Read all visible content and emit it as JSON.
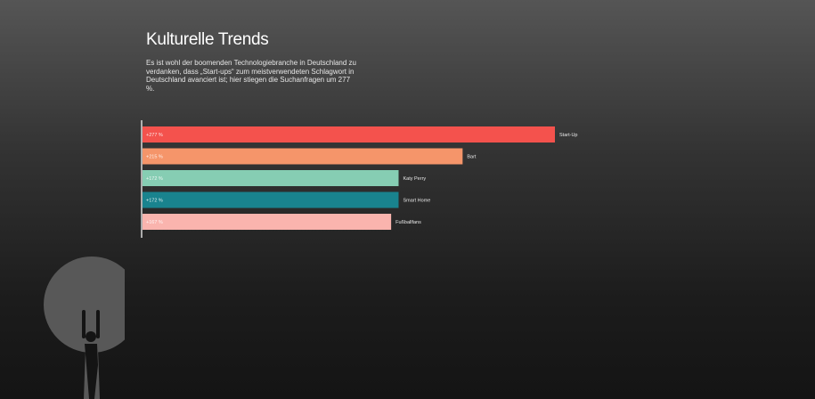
{
  "header": {
    "title": "Kulturelle Trends",
    "description": "Es ist wohl der boomenden Technologiebranche in Deutschland zu verdanken, dass „Start-ups“ zum meistverwendeten Schlagwort in Deutschland avanciert ist; hier stiegen die Suchanfragen um 277 %."
  },
  "chart_data": {
    "type": "bar",
    "orientation": "horizontal",
    "categories": [
      "Start-Up",
      "Bart",
      "Katy Perry",
      "Smart Home",
      "Fußballfans"
    ],
    "values": [
      277,
      215,
      172,
      172,
      167
    ],
    "value_labels": [
      "+277 %",
      "+215 %",
      "+172 %",
      "+172 %",
      "+167 %"
    ],
    "colors": [
      "#f4524d",
      "#f5956a",
      "#86cdb3",
      "#19838e",
      "#fab4ae"
    ],
    "xlim": [
      0,
      277
    ],
    "grid": false,
    "legend": "none"
  },
  "decorations": {
    "figure_icon": "person-holding-circle-icon",
    "figure_color": "#585858"
  }
}
